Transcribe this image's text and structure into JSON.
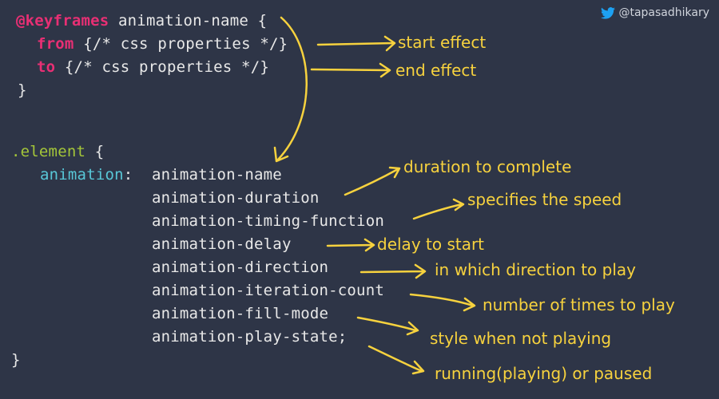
{
  "attribution": {
    "icon": "twitter-bird-icon",
    "handle": "@tapasadhikary"
  },
  "colors": {
    "background": "#2e3547",
    "keyword": "#e82f74",
    "selector": "#a4c639",
    "property": "#58c7d7",
    "annotation": "#f7d23e",
    "text": "#e8e8e8",
    "twitter": "#1da1f2"
  },
  "keyframes_block": {
    "keyword": "@keyframes",
    "name": " animation-name {",
    "lines": [
      {
        "keyword": "from",
        "rest": " {/* css properties */}"
      },
      {
        "keyword": "to",
        "rest": " {/* css properties */}"
      }
    ],
    "close": "}"
  },
  "element_block": {
    "selector": ".element",
    "open": " {",
    "property": "animation",
    "colon": ": ",
    "values": [
      "animation-name",
      "animation-duration",
      "animation-timing-function",
      "animation-delay",
      "animation-direction",
      "animation-iteration-count",
      "animation-fill-mode",
      "animation-play-state;"
    ],
    "close": "}"
  },
  "annotations": [
    "start effect",
    "end effect",
    "duration to complete",
    "specifies the speed",
    "delay to start",
    "in which direction to play",
    "number of times to play",
    "style when not playing",
    "running(playing) or paused"
  ]
}
